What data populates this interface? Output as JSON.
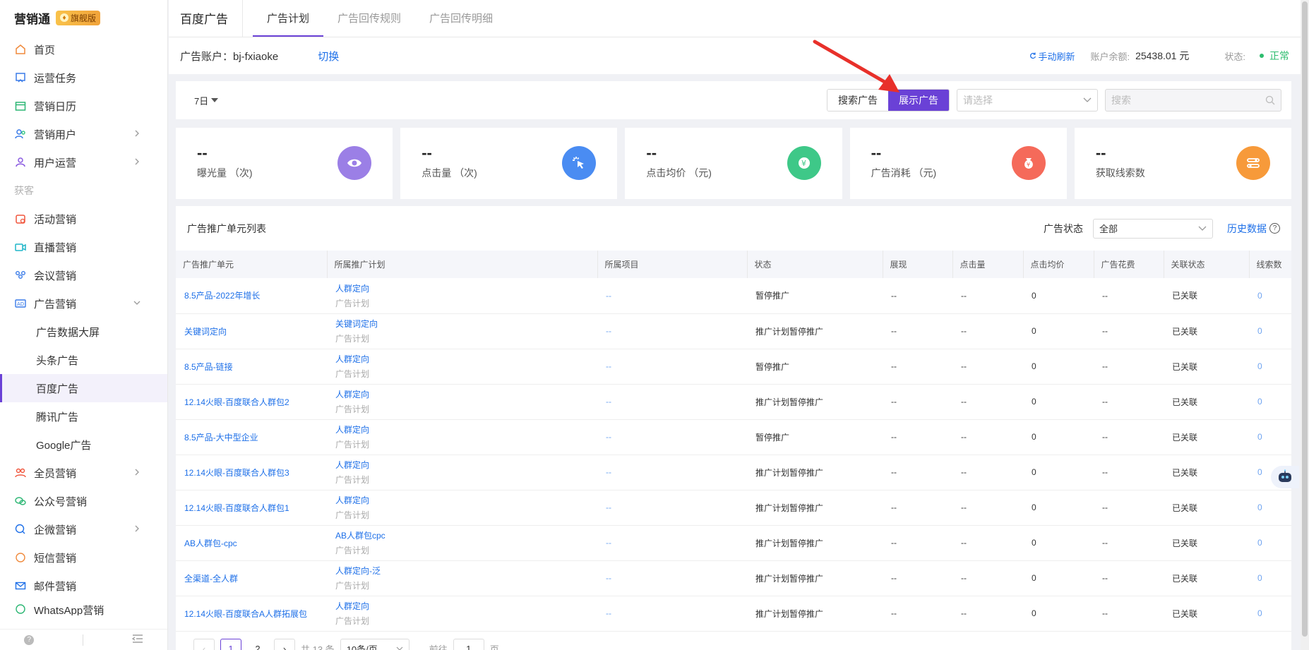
{
  "brand": {
    "name": "营销通",
    "badge": "旗舰版"
  },
  "sidebar": {
    "items": [
      {
        "label": "首页",
        "icon": "home-icon",
        "has_arrow": false
      },
      {
        "label": "运营任务",
        "icon": "task-icon",
        "has_arrow": false
      },
      {
        "label": "营销日历",
        "icon": "calendar-icon",
        "has_arrow": false
      },
      {
        "label": "营销用户",
        "icon": "users-icon",
        "has_arrow": true
      },
      {
        "label": "用户运营",
        "icon": "user-ops-icon",
        "has_arrow": true
      }
    ],
    "section": "获客",
    "items2": [
      {
        "label": "活动营销",
        "icon": "activity-icon"
      },
      {
        "label": "直播营销",
        "icon": "live-icon"
      },
      {
        "label": "会议营销",
        "icon": "meeting-icon"
      },
      {
        "label": "广告营销",
        "icon": "ad-icon"
      }
    ],
    "submenu": [
      "广告数据大屏",
      "头条广告",
      "百度广告",
      "腾讯广告",
      "Google广告"
    ],
    "items3": [
      {
        "label": "全员营销",
        "icon": "staff-icon"
      },
      {
        "label": "公众号营销",
        "icon": "wechat-icon"
      },
      {
        "label": "企微营销",
        "icon": "wework-icon"
      },
      {
        "label": "短信营销",
        "icon": "sms-icon"
      },
      {
        "label": "邮件营销",
        "icon": "mail-icon"
      },
      {
        "label": "WhatsApp营销",
        "icon": "whatsapp-icon"
      }
    ]
  },
  "header": {
    "title": "百度广告",
    "tabs": [
      "广告计划",
      "广告回传规则",
      "广告回传明细"
    ]
  },
  "account": {
    "label": "广告账户：bj-fxiaoke",
    "switch": "切换",
    "refresh": "手动刷新",
    "balance_label": "账户余额:",
    "balance_value": "25438.01 元",
    "status_label": "状态:",
    "status_value": "正常"
  },
  "filter": {
    "days": "7日",
    "seg": [
      "搜索广告",
      "展示广告"
    ],
    "select_placeholder": "请选择",
    "search_placeholder": "搜索"
  },
  "cards": [
    {
      "value": "--",
      "label": "曝光量 （次)",
      "icon": "eye-icon",
      "color": "#9b7fe6"
    },
    {
      "value": "--",
      "label": "点击量 （次)",
      "icon": "click-icon",
      "color": "#4a8cf2"
    },
    {
      "value": "--",
      "label": "点击均价 （元)",
      "icon": "price-icon",
      "color": "#3ec888"
    },
    {
      "value": "--",
      "label": "广告消耗 （元)",
      "icon": "money-bag-icon",
      "color": "#f56a5a"
    },
    {
      "value": "--",
      "label": "获取线索数",
      "icon": "leads-icon",
      "color": "#f79a3a"
    }
  ],
  "table": {
    "title": "广告推广单元列表",
    "status_label": "广告状态",
    "status_value": "全部",
    "history": "历史数据",
    "columns": [
      "广告推广单元",
      "所属推广计划",
      "所属项目",
      "状态",
      "展现",
      "点击量",
      "点击均价",
      "广告花费",
      "关联状态",
      "线索数"
    ],
    "rows": [
      {
        "unit": "8.5产品-2022年增长",
        "plan": "人群定向",
        "plan_sub": "广告计划",
        "project": "--",
        "status": "暂停推广",
        "show": "--",
        "clicks": "--",
        "cpc": "0",
        "cost": "--",
        "link": "已关联",
        "leads": "0"
      },
      {
        "unit": "关键词定向",
        "plan": "关键词定向",
        "plan_sub": "广告计划",
        "project": "--",
        "status": "推广计划暂停推广",
        "show": "--",
        "clicks": "--",
        "cpc": "0",
        "cost": "--",
        "link": "已关联",
        "leads": "0"
      },
      {
        "unit": "8.5产品-链接",
        "plan": "人群定向",
        "plan_sub": "广告计划",
        "project": "--",
        "status": "暂停推广",
        "show": "--",
        "clicks": "--",
        "cpc": "0",
        "cost": "--",
        "link": "已关联",
        "leads": "0"
      },
      {
        "unit": "12.14火眼-百度联合人群包2",
        "plan": "人群定向",
        "plan_sub": "广告计划",
        "project": "--",
        "status": "推广计划暂停推广",
        "show": "--",
        "clicks": "--",
        "cpc": "0",
        "cost": "--",
        "link": "已关联",
        "leads": "0"
      },
      {
        "unit": "8.5产品-大中型企业",
        "plan": "人群定向",
        "plan_sub": "广告计划",
        "project": "--",
        "status": "暂停推广",
        "show": "--",
        "clicks": "--",
        "cpc": "0",
        "cost": "--",
        "link": "已关联",
        "leads": "0"
      },
      {
        "unit": "12.14火眼-百度联合人群包3",
        "plan": "人群定向",
        "plan_sub": "广告计划",
        "project": "--",
        "status": "推广计划暂停推广",
        "show": "--",
        "clicks": "--",
        "cpc": "0",
        "cost": "--",
        "link": "已关联",
        "leads": "0"
      },
      {
        "unit": "12.14火眼-百度联合人群包1",
        "plan": "人群定向",
        "plan_sub": "广告计划",
        "project": "--",
        "status": "推广计划暂停推广",
        "show": "--",
        "clicks": "--",
        "cpc": "0",
        "cost": "--",
        "link": "已关联",
        "leads": "0"
      },
      {
        "unit": "AB人群包-cpc",
        "plan": "AB人群包cpc",
        "plan_sub": "广告计划",
        "project": "--",
        "status": "推广计划暂停推广",
        "show": "--",
        "clicks": "--",
        "cpc": "0",
        "cost": "--",
        "link": "已关联",
        "leads": "0"
      },
      {
        "unit": "全渠道-全人群",
        "plan": "人群定向-泛",
        "plan_sub": "广告计划",
        "project": "--",
        "status": "推广计划暂停推广",
        "show": "--",
        "clicks": "--",
        "cpc": "0",
        "cost": "--",
        "link": "已关联",
        "leads": "0"
      },
      {
        "unit": "12.14火眼-百度联合A人群拓展包",
        "plan": "人群定向",
        "plan_sub": "广告计划",
        "project": "--",
        "status": "推广计划暂停推广",
        "show": "--",
        "clicks": "--",
        "cpc": "0",
        "cost": "--",
        "link": "已关联",
        "leads": "0"
      }
    ]
  },
  "pagination": {
    "pages": [
      "1",
      "2"
    ],
    "total": "共 13 条",
    "size": "10条/页",
    "goto_label": "前往",
    "goto_value": "1",
    "page_suffix": "页"
  },
  "colors": {
    "accent": "#6a41d6",
    "link": "#1d6fe8",
    "ok": "#2dbd6e",
    "arrow": "#e8302a"
  }
}
